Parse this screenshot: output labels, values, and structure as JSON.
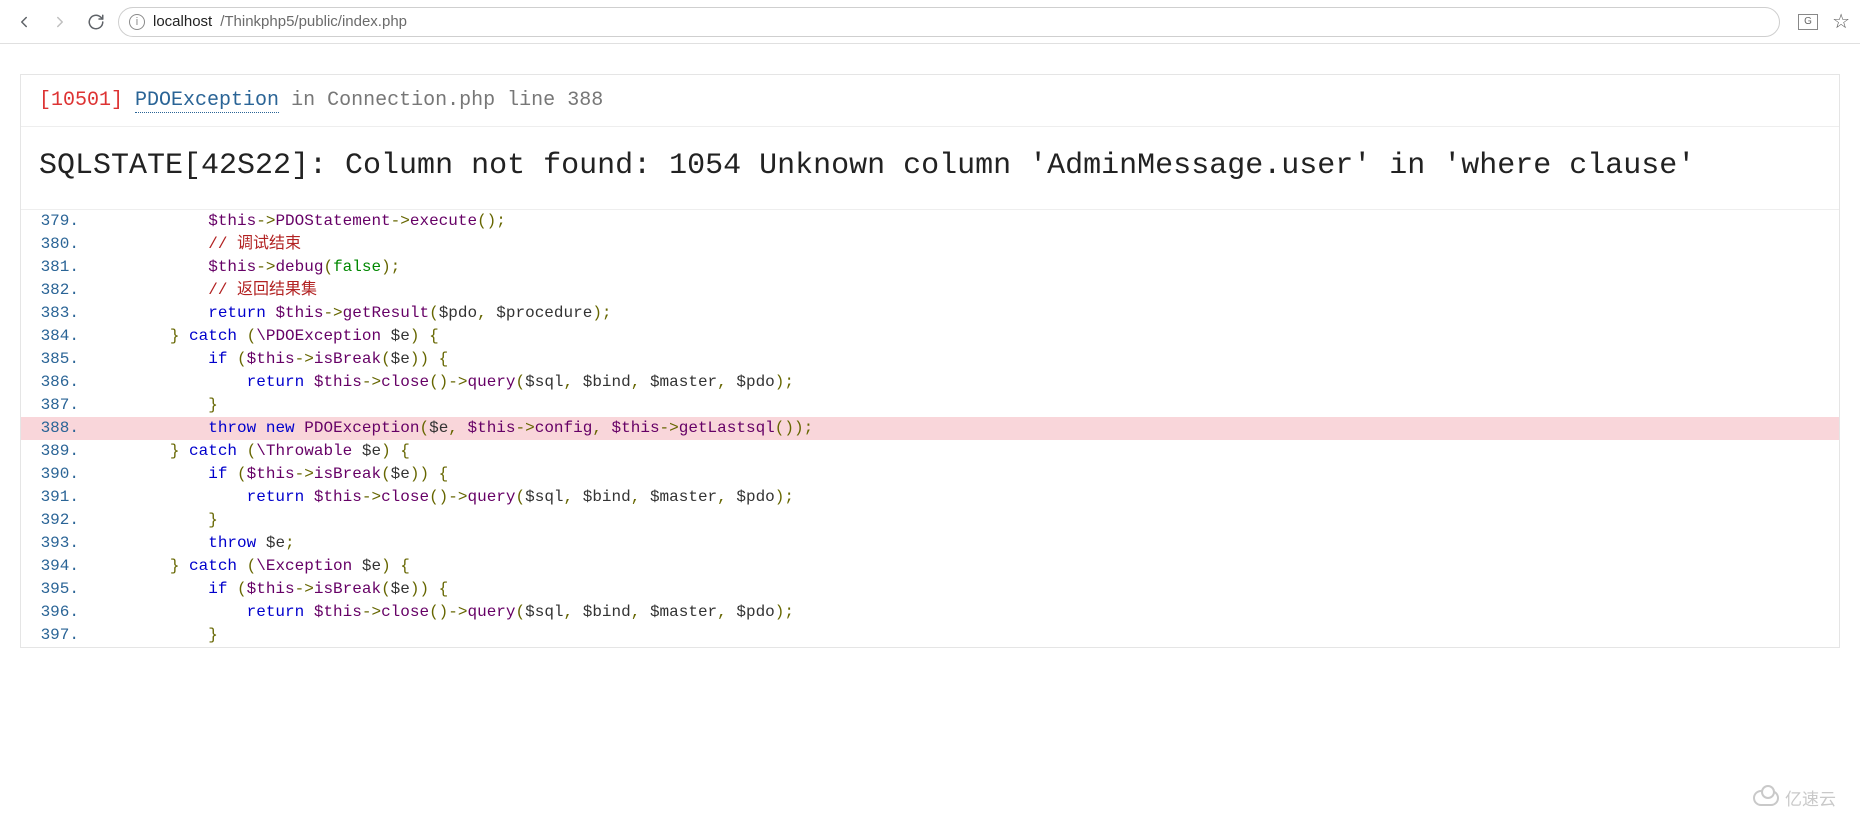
{
  "browser": {
    "url_host": "localhost",
    "url_path": "/Thinkphp5/public/index.php"
  },
  "error": {
    "code": "[10501]",
    "class": "PDOException",
    "in_kw": "in",
    "file": "Connection.php",
    "line_kw": "line",
    "line": "388",
    "message": "SQLSTATE[42S22]: Column not found: 1054 Unknown column 'AdminMessage.user' in 'where clause'"
  },
  "source": {
    "highlight_line": 388,
    "lines": [
      {
        "n": 379,
        "tokens": [
          {
            "cls": "",
            "t": "            "
          },
          {
            "cls": "tok-builtin",
            "t": "$this"
          },
          {
            "cls": "tok-arrow",
            "t": "->"
          },
          {
            "cls": "tok-func",
            "t": "PDOStatement"
          },
          {
            "cls": "tok-arrow",
            "t": "->"
          },
          {
            "cls": "tok-func",
            "t": "execute"
          },
          {
            "cls": "tok-paren",
            "t": "();"
          }
        ]
      },
      {
        "n": 380,
        "tokens": [
          {
            "cls": "",
            "t": "            "
          },
          {
            "cls": "tok-comm",
            "t": "// 调试结束"
          }
        ]
      },
      {
        "n": 381,
        "tokens": [
          {
            "cls": "",
            "t": "            "
          },
          {
            "cls": "tok-builtin",
            "t": "$this"
          },
          {
            "cls": "tok-arrow",
            "t": "->"
          },
          {
            "cls": "tok-func",
            "t": "debug"
          },
          {
            "cls": "tok-paren",
            "t": "("
          },
          {
            "cls": "tok-const",
            "t": "false"
          },
          {
            "cls": "tok-paren",
            "t": ");"
          }
        ]
      },
      {
        "n": 382,
        "tokens": [
          {
            "cls": "",
            "t": "            "
          },
          {
            "cls": "tok-comm",
            "t": "// 返回结果集"
          }
        ]
      },
      {
        "n": 383,
        "tokens": [
          {
            "cls": "",
            "t": "            "
          },
          {
            "cls": "tok-kw",
            "t": "return"
          },
          {
            "cls": "",
            "t": " "
          },
          {
            "cls": "tok-builtin",
            "t": "$this"
          },
          {
            "cls": "tok-arrow",
            "t": "->"
          },
          {
            "cls": "tok-func",
            "t": "getResult"
          },
          {
            "cls": "tok-paren",
            "t": "("
          },
          {
            "cls": "tok-var",
            "t": "$pdo"
          },
          {
            "cls": "tok-paren",
            "t": ", "
          },
          {
            "cls": "tok-var",
            "t": "$procedure"
          },
          {
            "cls": "tok-paren",
            "t": ");"
          }
        ]
      },
      {
        "n": 384,
        "tokens": [
          {
            "cls": "",
            "t": "        "
          },
          {
            "cls": "tok-paren",
            "t": "} "
          },
          {
            "cls": "tok-kw",
            "t": "catch"
          },
          {
            "cls": "tok-paren",
            "t": " ("
          },
          {
            "cls": "tok-class",
            "t": "\\PDOException"
          },
          {
            "cls": "",
            "t": " "
          },
          {
            "cls": "tok-var",
            "t": "$e"
          },
          {
            "cls": "tok-paren",
            "t": ") {"
          }
        ]
      },
      {
        "n": 385,
        "tokens": [
          {
            "cls": "",
            "t": "            "
          },
          {
            "cls": "tok-kw",
            "t": "if"
          },
          {
            "cls": "tok-paren",
            "t": " ("
          },
          {
            "cls": "tok-builtin",
            "t": "$this"
          },
          {
            "cls": "tok-arrow",
            "t": "->"
          },
          {
            "cls": "tok-func",
            "t": "isBreak"
          },
          {
            "cls": "tok-paren",
            "t": "("
          },
          {
            "cls": "tok-var",
            "t": "$e"
          },
          {
            "cls": "tok-paren",
            "t": ")) {"
          }
        ]
      },
      {
        "n": 386,
        "tokens": [
          {
            "cls": "",
            "t": "                "
          },
          {
            "cls": "tok-kw",
            "t": "return"
          },
          {
            "cls": "",
            "t": " "
          },
          {
            "cls": "tok-builtin",
            "t": "$this"
          },
          {
            "cls": "tok-arrow",
            "t": "->"
          },
          {
            "cls": "tok-func",
            "t": "close"
          },
          {
            "cls": "tok-paren",
            "t": "()"
          },
          {
            "cls": "tok-arrow",
            "t": "->"
          },
          {
            "cls": "tok-func",
            "t": "query"
          },
          {
            "cls": "tok-paren",
            "t": "("
          },
          {
            "cls": "tok-var",
            "t": "$sql"
          },
          {
            "cls": "tok-paren",
            "t": ", "
          },
          {
            "cls": "tok-var",
            "t": "$bind"
          },
          {
            "cls": "tok-paren",
            "t": ", "
          },
          {
            "cls": "tok-var",
            "t": "$master"
          },
          {
            "cls": "tok-paren",
            "t": ", "
          },
          {
            "cls": "tok-var",
            "t": "$pdo"
          },
          {
            "cls": "tok-paren",
            "t": ");"
          }
        ]
      },
      {
        "n": 387,
        "tokens": [
          {
            "cls": "",
            "t": "            "
          },
          {
            "cls": "tok-paren",
            "t": "}"
          }
        ]
      },
      {
        "n": 388,
        "tokens": [
          {
            "cls": "",
            "t": "            "
          },
          {
            "cls": "tok-kw",
            "t": "throw"
          },
          {
            "cls": "",
            "t": " "
          },
          {
            "cls": "tok-kw",
            "t": "new"
          },
          {
            "cls": "",
            "t": " "
          },
          {
            "cls": "tok-class",
            "t": "PDOException"
          },
          {
            "cls": "tok-paren",
            "t": "("
          },
          {
            "cls": "tok-var",
            "t": "$e"
          },
          {
            "cls": "tok-paren",
            "t": ", "
          },
          {
            "cls": "tok-builtin",
            "t": "$this"
          },
          {
            "cls": "tok-arrow",
            "t": "->"
          },
          {
            "cls": "tok-func",
            "t": "config"
          },
          {
            "cls": "tok-paren",
            "t": ", "
          },
          {
            "cls": "tok-builtin",
            "t": "$this"
          },
          {
            "cls": "tok-arrow",
            "t": "->"
          },
          {
            "cls": "tok-func",
            "t": "getLastsql"
          },
          {
            "cls": "tok-paren",
            "t": "());"
          }
        ]
      },
      {
        "n": 389,
        "tokens": [
          {
            "cls": "",
            "t": "        "
          },
          {
            "cls": "tok-paren",
            "t": "} "
          },
          {
            "cls": "tok-kw",
            "t": "catch"
          },
          {
            "cls": "tok-paren",
            "t": " ("
          },
          {
            "cls": "tok-class",
            "t": "\\Throwable"
          },
          {
            "cls": "",
            "t": " "
          },
          {
            "cls": "tok-var",
            "t": "$e"
          },
          {
            "cls": "tok-paren",
            "t": ") {"
          }
        ]
      },
      {
        "n": 390,
        "tokens": [
          {
            "cls": "",
            "t": "            "
          },
          {
            "cls": "tok-kw",
            "t": "if"
          },
          {
            "cls": "tok-paren",
            "t": " ("
          },
          {
            "cls": "tok-builtin",
            "t": "$this"
          },
          {
            "cls": "tok-arrow",
            "t": "->"
          },
          {
            "cls": "tok-func",
            "t": "isBreak"
          },
          {
            "cls": "tok-paren",
            "t": "("
          },
          {
            "cls": "tok-var",
            "t": "$e"
          },
          {
            "cls": "tok-paren",
            "t": ")) {"
          }
        ]
      },
      {
        "n": 391,
        "tokens": [
          {
            "cls": "",
            "t": "                "
          },
          {
            "cls": "tok-kw",
            "t": "return"
          },
          {
            "cls": "",
            "t": " "
          },
          {
            "cls": "tok-builtin",
            "t": "$this"
          },
          {
            "cls": "tok-arrow",
            "t": "->"
          },
          {
            "cls": "tok-func",
            "t": "close"
          },
          {
            "cls": "tok-paren",
            "t": "()"
          },
          {
            "cls": "tok-arrow",
            "t": "->"
          },
          {
            "cls": "tok-func",
            "t": "query"
          },
          {
            "cls": "tok-paren",
            "t": "("
          },
          {
            "cls": "tok-var",
            "t": "$sql"
          },
          {
            "cls": "tok-paren",
            "t": ", "
          },
          {
            "cls": "tok-var",
            "t": "$bind"
          },
          {
            "cls": "tok-paren",
            "t": ", "
          },
          {
            "cls": "tok-var",
            "t": "$master"
          },
          {
            "cls": "tok-paren",
            "t": ", "
          },
          {
            "cls": "tok-var",
            "t": "$pdo"
          },
          {
            "cls": "tok-paren",
            "t": ");"
          }
        ]
      },
      {
        "n": 392,
        "tokens": [
          {
            "cls": "",
            "t": "            "
          },
          {
            "cls": "tok-paren",
            "t": "}"
          }
        ]
      },
      {
        "n": 393,
        "tokens": [
          {
            "cls": "",
            "t": "            "
          },
          {
            "cls": "tok-kw",
            "t": "throw"
          },
          {
            "cls": "",
            "t": " "
          },
          {
            "cls": "tok-var",
            "t": "$e"
          },
          {
            "cls": "tok-paren",
            "t": ";"
          }
        ]
      },
      {
        "n": 394,
        "tokens": [
          {
            "cls": "",
            "t": "        "
          },
          {
            "cls": "tok-paren",
            "t": "} "
          },
          {
            "cls": "tok-kw",
            "t": "catch"
          },
          {
            "cls": "tok-paren",
            "t": " ("
          },
          {
            "cls": "tok-class",
            "t": "\\Exception"
          },
          {
            "cls": "",
            "t": " "
          },
          {
            "cls": "tok-var",
            "t": "$e"
          },
          {
            "cls": "tok-paren",
            "t": ") {"
          }
        ]
      },
      {
        "n": 395,
        "tokens": [
          {
            "cls": "",
            "t": "            "
          },
          {
            "cls": "tok-kw",
            "t": "if"
          },
          {
            "cls": "tok-paren",
            "t": " ("
          },
          {
            "cls": "tok-builtin",
            "t": "$this"
          },
          {
            "cls": "tok-arrow",
            "t": "->"
          },
          {
            "cls": "tok-func",
            "t": "isBreak"
          },
          {
            "cls": "tok-paren",
            "t": "("
          },
          {
            "cls": "tok-var",
            "t": "$e"
          },
          {
            "cls": "tok-paren",
            "t": ")) {"
          }
        ]
      },
      {
        "n": 396,
        "tokens": [
          {
            "cls": "",
            "t": "                "
          },
          {
            "cls": "tok-kw",
            "t": "return"
          },
          {
            "cls": "",
            "t": " "
          },
          {
            "cls": "tok-builtin",
            "t": "$this"
          },
          {
            "cls": "tok-arrow",
            "t": "->"
          },
          {
            "cls": "tok-func",
            "t": "close"
          },
          {
            "cls": "tok-paren",
            "t": "()"
          },
          {
            "cls": "tok-arrow",
            "t": "->"
          },
          {
            "cls": "tok-func",
            "t": "query"
          },
          {
            "cls": "tok-paren",
            "t": "("
          },
          {
            "cls": "tok-var",
            "t": "$sql"
          },
          {
            "cls": "tok-paren",
            "t": ", "
          },
          {
            "cls": "tok-var",
            "t": "$bind"
          },
          {
            "cls": "tok-paren",
            "t": ", "
          },
          {
            "cls": "tok-var",
            "t": "$master"
          },
          {
            "cls": "tok-paren",
            "t": ", "
          },
          {
            "cls": "tok-var",
            "t": "$pdo"
          },
          {
            "cls": "tok-paren",
            "t": ");"
          }
        ]
      },
      {
        "n": 397,
        "tokens": [
          {
            "cls": "",
            "t": "            "
          },
          {
            "cls": "tok-paren",
            "t": "}"
          }
        ]
      }
    ]
  },
  "watermark": {
    "text": "亿速云"
  }
}
